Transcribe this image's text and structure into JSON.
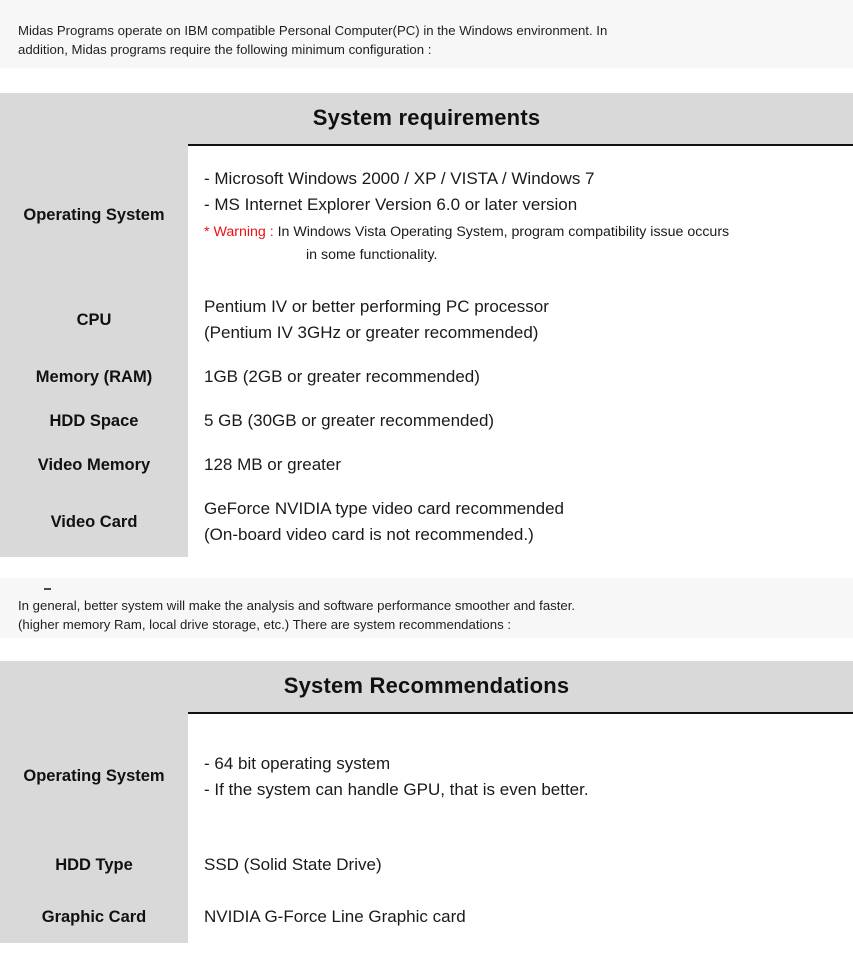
{
  "intro": {
    "line1": "Midas Programs operate on IBM compatible Personal Computer(PC) in the Windows environment. In",
    "line2": "addition, Midas programs require the following minimum configuration :"
  },
  "middle_note": {
    "line1": "In general, better system will make the analysis and software performance smoother and faster.",
    "line2": "(higher memory Ram, local drive storage, etc.) There are system recommendations :"
  },
  "colors": {
    "header_gray": "#d9d9d9",
    "note_background": "#f7f7f7",
    "warning_red": "#ee1111",
    "border_black": "#111111"
  },
  "system_requirements": {
    "title": "System requirements",
    "rows": [
      {
        "label": "Operating System",
        "lines": [
          "- Microsoft Windows 2000 / XP / VISTA / Windows 7",
          "- MS Internet Explorer Version 6.0 or later version"
        ],
        "warning_flag": "* Warning :",
        "warning_text": " In Windows Vista Operating System, program compatibility issue occurs",
        "warning_text2": "in some functionality."
      },
      {
        "label": "CPU",
        "lines": [
          "Pentium IV or better performing PC processor",
          "(Pentium IV 3GHz or greater recommended)"
        ]
      },
      {
        "label": "Memory (RAM)",
        "lines": [
          "1GB (2GB or greater recommended)"
        ]
      },
      {
        "label": "HDD Space",
        "lines": [
          "5 GB (30GB or greater recommended)"
        ]
      },
      {
        "label": "Video Memory",
        "lines": [
          "128 MB or greater"
        ]
      },
      {
        "label": "Video Card",
        "lines": [
          "GeForce NVIDIA type video card recommended",
          "(On-board video card is not recommended.)"
        ]
      }
    ]
  },
  "system_recommendations": {
    "title": "System Recommendations",
    "rows": [
      {
        "label": "Operating System",
        "lines": [
          "- 64 bit operating system",
          "- If the system can handle GPU, that is even better."
        ]
      },
      {
        "label": "HDD Type",
        "lines": [
          "SSD (Solid State Drive)"
        ]
      },
      {
        "label": "Graphic Card",
        "lines": [
          "NVIDIA G-Force Line Graphic card"
        ]
      }
    ]
  }
}
